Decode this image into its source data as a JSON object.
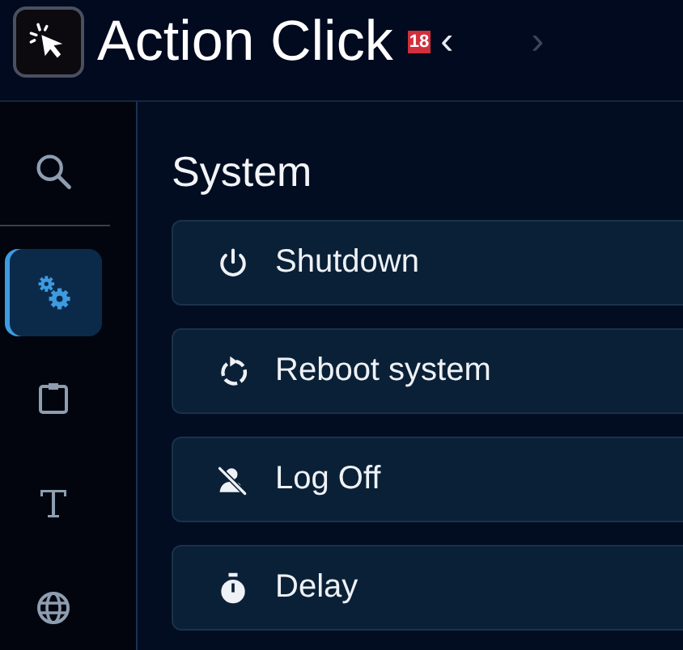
{
  "header": {
    "title": "Action Click",
    "badge": "18",
    "nav": [
      {
        "label": "‹",
        "disabled": false
      },
      {
        "label": "›",
        "disabled": true
      }
    ]
  },
  "sidebar": {
    "search": {
      "selected": false
    },
    "items": [
      {
        "kind": "gears",
        "selected": true
      },
      {
        "kind": "clipboard",
        "selected": false
      },
      {
        "kind": "text",
        "selected": false
      },
      {
        "kind": "globe",
        "selected": false
      }
    ]
  },
  "section": {
    "title": "System",
    "actions": [
      {
        "kind": "power",
        "label": "Shutdown"
      },
      {
        "kind": "reboot",
        "label": "Reboot system"
      },
      {
        "kind": "logoff",
        "label": "Log Off"
      },
      {
        "kind": "timer",
        "label": "Delay"
      }
    ]
  }
}
